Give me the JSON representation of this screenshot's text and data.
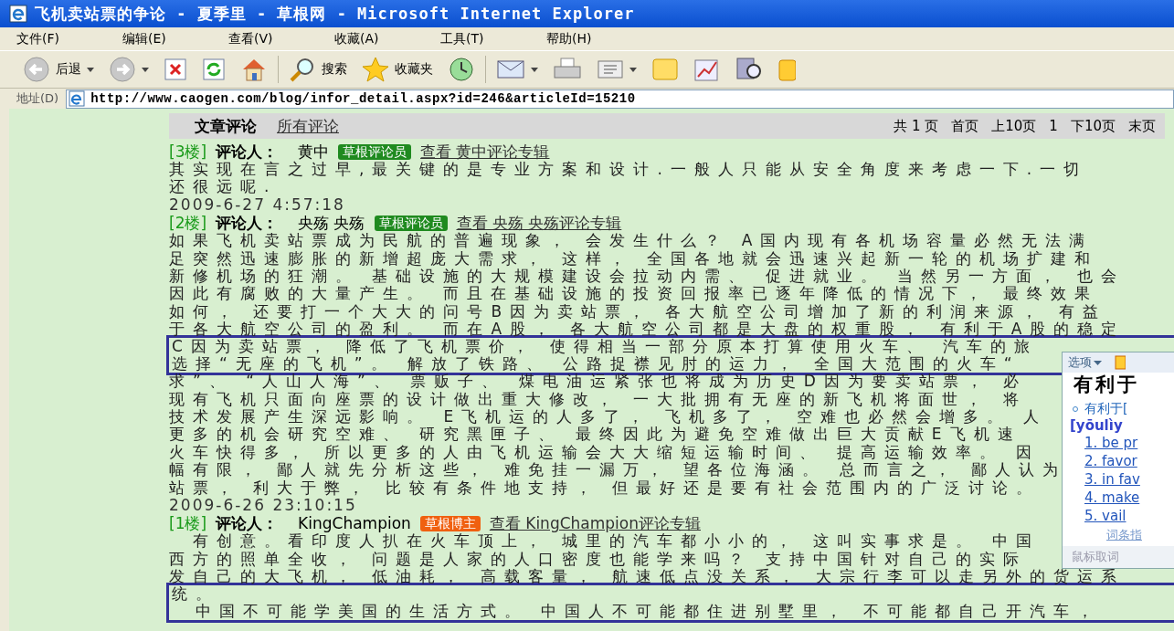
{
  "window": {
    "title": "飞机卖站票的争论 - 夏季里 - 草根网 - Microsoft Internet Explorer"
  },
  "menu": [
    "文件(F)",
    "编辑(E)",
    "查看(V)",
    "收藏(A)",
    "工具(T)",
    "帮助(H)"
  ],
  "toolbar": [
    {
      "kind": "back",
      "label": "后退",
      "dropdown": true
    },
    {
      "kind": "forward",
      "dropdown": true
    },
    {
      "kind": "stop"
    },
    {
      "kind": "refresh"
    },
    {
      "kind": "home"
    },
    {
      "kind": "search",
      "label": "搜索"
    },
    {
      "kind": "favorites",
      "label": "收藏夹"
    },
    {
      "kind": "history"
    },
    {
      "kind": "mail",
      "dropdown": true
    },
    {
      "kind": "print"
    },
    {
      "kind": "edit",
      "dropdown": true
    },
    {
      "kind": "note"
    },
    {
      "kind": "chart"
    },
    {
      "kind": "research"
    },
    {
      "kind": "folder"
    }
  ],
  "address": {
    "label": "地址(D)",
    "url": "http://www.caogen.com/blog/infor_detail.aspx?id=246&articleId=15210"
  },
  "comments_header": {
    "title": "文章评论",
    "link": "所有评论",
    "pagination": [
      "共 1 页",
      "首页",
      "上10页",
      "1",
      "下10页",
      "末页"
    ]
  },
  "comments": [
    {
      "floor": "[3楼]",
      "label": "评论人：",
      "author": "黄中",
      "badge": {
        "text": "草根评论员",
        "color": "#1f8a1f"
      },
      "link": "查看 黄中评论专辑",
      "blocks": [
        {
          "highlighted": false,
          "lines": [
            "其实现在言之过早,最关键的是专业方案和设计.一般人只能从安全角度来考虑一下.一切",
            "还很远呢."
          ]
        }
      ],
      "timestamp": "2009-6-27 4:57:18"
    },
    {
      "floor": "[2楼]",
      "label": "评论人：",
      "author": "央殇 央殇",
      "badge": {
        "text": "草根评论员",
        "color": "#1f8a1f"
      },
      "link": "查看 央殇 央殇评论专辑",
      "blocks": [
        {
          "highlighted": false,
          "lines": [
            "如果飞机卖站票成为民航的普遍现象， 会发生什么？ A国内现有各机场容量必然无法满",
            "足突然迅速膨胀的新增超庞大需求， 这样， 全国各地就会迅速兴起新一轮的机场扩建和",
            "新修机场的狂潮。 基础设施的大规模建设会拉动内需、 促进就业。 当然另一方面， 也会",
            "因此有腐败的大量产生。 而且在基础设施的投资回报率已逐年降低的情况下， 最终效果",
            "如何， 还要打一个大大的问号B因为卖站票， 各大航空公司增加了新的利润来源， 有益",
            "于各大航空公司的盈利。 而在A股， 各大航空公司都是大盘的权重股， 有利于A股的稳定"
          ]
        },
        {
          "highlighted": true,
          "lines": [
            "C因为卖站票， 降低了飞机票价， 使得相当一部分原本打算使用火车、 汽车的旅",
            "选择“无座的飞机”。 解放了铁路、 公路捉襟见肘的运力， 全国大范围的火车“"
          ]
        },
        {
          "highlighted": false,
          "lines": [
            "求”、 “人山人海”、 票贩子、 煤电油运紧张也将成为历史D因为要卖站票， 必",
            "现有飞机只面向座票的设计做出重大修改， 一大批拥有无座的新飞机将面世， 将",
            "技术发展产生深远影响。 E飞机运的人多了， 飞机多了， 空难也必然会增多。 人",
            "更多的机会研究空难、 研究黑匣子、 最终因此为避免空难做出巨大贡献E飞机速",
            "火车快得多， 所以更多的人由飞机运输会大大缩短运输时间、 提高运输效率。 因",
            "幅有限， 鄙人就先分析这些， 难免挂一漏万， 望各位海涵。 总而言之， 鄙人认为",
            "站票， 利大于弊， 比较有条件地支持， 但最好还是要有社会范围内的广泛讨论。"
          ]
        }
      ],
      "timestamp": "2009-6-26 23:10:15"
    },
    {
      "floor": "[1楼]",
      "label": "评论人：",
      "author": "KingChampion",
      "badge": {
        "text": "草根博主",
        "color": "#f06010"
      },
      "link": "查看 KingChampion评论专辑",
      "blocks": [
        {
          "highlighted": false,
          "lines": [
            "　有创意。看印度人扒在火车顶上， 城里的汽车都小小的， 这叫实事求是。 中国",
            "西方的照单全收， 问题是人家的人口密度也能学来吗？ 支持中国针对自己的实际",
            "发自己的大飞机， 低油耗， 高载客量， 航速低点没关系， 大宗行李可以走另外的货运系"
          ]
        },
        {
          "highlighted": true,
          "lines": [
            "统。",
            "　中国不可能学美国的生活方式。 中国人不可能都住进别墅里， 不可能都自己开汽车，"
          ]
        }
      ]
    }
  ],
  "popup": {
    "options": "选项",
    "heading": "有利于",
    "entry": "有利于[",
    "pinyin": "[yōulìy",
    "senses": [
      "1. be pr",
      "2. favor",
      "3. in fav",
      "4. make",
      "5. vail"
    ],
    "more": "词条指",
    "footer": "鼠标取词"
  }
}
